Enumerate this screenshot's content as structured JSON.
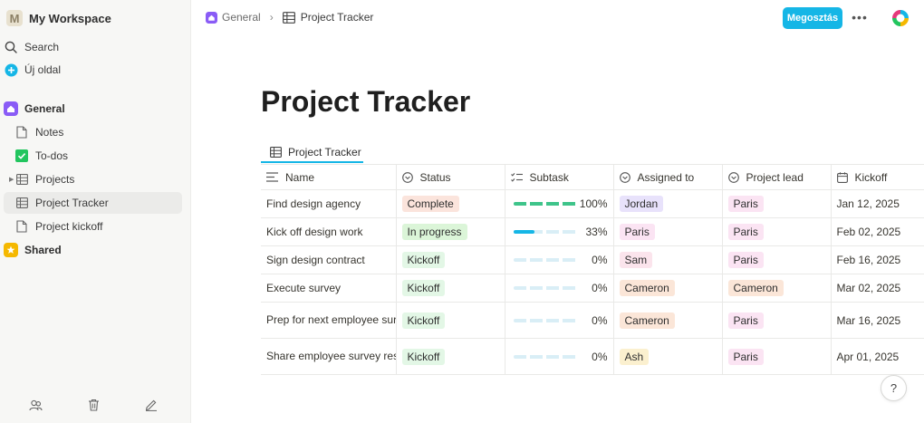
{
  "workspace": {
    "initial": "M",
    "name": "My Workspace"
  },
  "sidebar": {
    "search": "Search",
    "new_page": "Új oldal",
    "general_group": "General",
    "items": [
      {
        "label": "Notes"
      },
      {
        "label": "To-dos"
      },
      {
        "label": "Projects"
      },
      {
        "label": "Project Tracker"
      },
      {
        "label": "Project kickoff"
      }
    ],
    "shared_group": "Shared"
  },
  "breadcrumb": {
    "parent": "General",
    "current": "Project Tracker"
  },
  "topbar": {
    "share_label": "Megosztás",
    "more_label": "•••"
  },
  "page": {
    "title": "Project Tracker",
    "view_tab": "Project Tracker"
  },
  "table": {
    "columns": [
      "Name",
      "Status",
      "Subtask",
      "Assigned to",
      "Project lead",
      "Kickoff"
    ],
    "rows": [
      {
        "name": "Find design agency",
        "status": "Complete",
        "progress": 100,
        "progress_label": "100%",
        "assigned": "Jordan",
        "lead": "Paris",
        "kickoff": "Jan 12, 2025"
      },
      {
        "name": "Kick off design work",
        "status": "In progress",
        "progress": 33,
        "progress_label": "33%",
        "assigned": "Paris",
        "lead": "Paris",
        "kickoff": "Feb 02, 2025"
      },
      {
        "name": "Sign design contract",
        "status": "Kickoff",
        "progress": 0,
        "progress_label": "0%",
        "assigned": "Sam",
        "lead": "Paris",
        "kickoff": "Feb 16, 2025"
      },
      {
        "name": "Execute survey",
        "status": "Kickoff",
        "progress": 0,
        "progress_label": "0%",
        "assigned": "Cameron",
        "lead": "Cameron",
        "kickoff": "Mar 02, 2025"
      },
      {
        "name": "Prep for next employee survey",
        "status": "Kickoff",
        "progress": 0,
        "progress_label": "0%",
        "assigned": "Cameron",
        "lead": "Paris",
        "kickoff": "Mar 16, 2025"
      },
      {
        "name": "Share employee survey results",
        "status": "Kickoff",
        "progress": 0,
        "progress_label": "0%",
        "assigned": "Ash",
        "lead": "Paris",
        "kickoff": "Apr 01, 2025"
      }
    ]
  },
  "help_label": "?",
  "colors": {
    "accent": "#15b6e6",
    "general_icon": "#8a5cf6",
    "shared_icon": "#f5b800",
    "todo_icon": "#22c55e"
  },
  "icons": [
    "search-icon",
    "plus-circle-icon",
    "home-icon",
    "page-icon",
    "checkbox-icon",
    "table-icon",
    "star-icon",
    "people-icon",
    "trash-icon",
    "pencil-icon",
    "help-icon"
  ]
}
